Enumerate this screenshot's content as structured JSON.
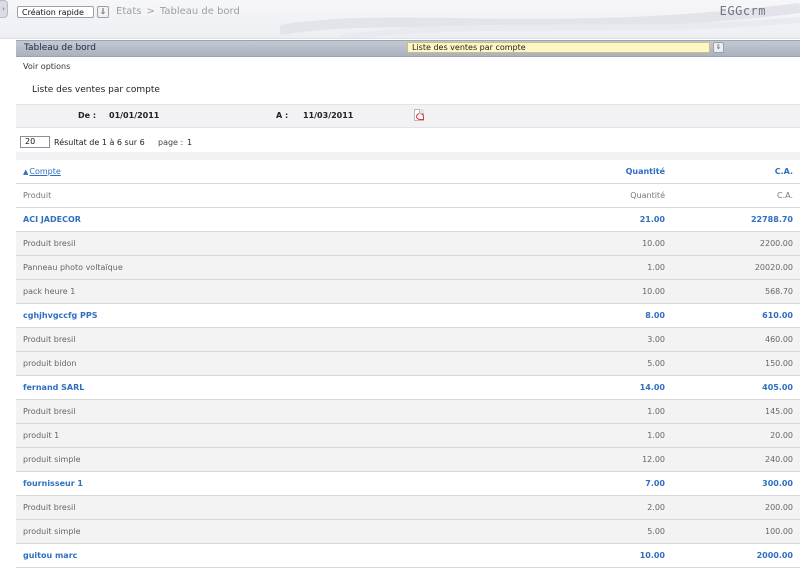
{
  "topbar": {
    "quick_create": "Création rapide",
    "breadcrumb": [
      "Etats",
      "Tableau de bord"
    ],
    "logo": "EGGcrm"
  },
  "dashboard": {
    "title": "Tableau de bord",
    "report_selected": "Liste des ventes par compte"
  },
  "options_link": "Voir options",
  "report": {
    "title": "Liste des ventes par compte",
    "from_label": "De :",
    "from_date": "01/01/2011",
    "to_label": "A :",
    "to_date": "11/03/2011"
  },
  "pager": {
    "per_page": "20",
    "result_text": "Résultat de 1 à 6 sur 6",
    "page_label": "page :",
    "page_number": "1"
  },
  "table": {
    "headers": {
      "account": "Compte",
      "quantity": "Quantité",
      "revenue": "C.A."
    },
    "subheaders": {
      "product": "Produit",
      "quantity": "Quantité",
      "revenue": "C.A."
    },
    "rows": [
      {
        "type": "account",
        "name": "ACI JADECOR",
        "quantity": "21.00",
        "revenue": "22788.70"
      },
      {
        "type": "product",
        "name": "Produit bresil",
        "quantity": "10.00",
        "revenue": "2200.00"
      },
      {
        "type": "product",
        "name": "Panneau photo voltaïque",
        "quantity": "1.00",
        "revenue": "20020.00"
      },
      {
        "type": "product",
        "name": "pack heure 1",
        "quantity": "10.00",
        "revenue": "568.70"
      },
      {
        "type": "account",
        "name": "cghjhvgccfg PPS",
        "quantity": "8.00",
        "revenue": "610.00"
      },
      {
        "type": "product",
        "name": "Produit bresil",
        "quantity": "3.00",
        "revenue": "460.00"
      },
      {
        "type": "product",
        "name": "produit bidon",
        "quantity": "5.00",
        "revenue": "150.00"
      },
      {
        "type": "account",
        "name": "fernand SARL",
        "quantity": "14.00",
        "revenue": "405.00"
      },
      {
        "type": "product",
        "name": "Produit bresil",
        "quantity": "1.00",
        "revenue": "145.00"
      },
      {
        "type": "product",
        "name": "produit 1",
        "quantity": "1.00",
        "revenue": "20.00"
      },
      {
        "type": "product",
        "name": "produit simple",
        "quantity": "12.00",
        "revenue": "240.00"
      },
      {
        "type": "account",
        "name": "fournisseur 1",
        "quantity": "7.00",
        "revenue": "300.00"
      },
      {
        "type": "product",
        "name": "Produit bresil",
        "quantity": "2.00",
        "revenue": "200.00"
      },
      {
        "type": "product",
        "name": "produit simple",
        "quantity": "5.00",
        "revenue": "100.00"
      },
      {
        "type": "account",
        "name": "guitou marc",
        "quantity": "10.00",
        "revenue": "2000.00"
      }
    ]
  },
  "icons": {
    "sidebar_toggle": "chevron-right-icon",
    "dropdown": "chevron-down-icon",
    "pdf_export": "pdf-icon",
    "sort": "sort-up-icon"
  },
  "colors": {
    "link_blue": "#2f6fc0",
    "header_bar": "#b7bec9",
    "report_select": "#fdf7c3"
  }
}
